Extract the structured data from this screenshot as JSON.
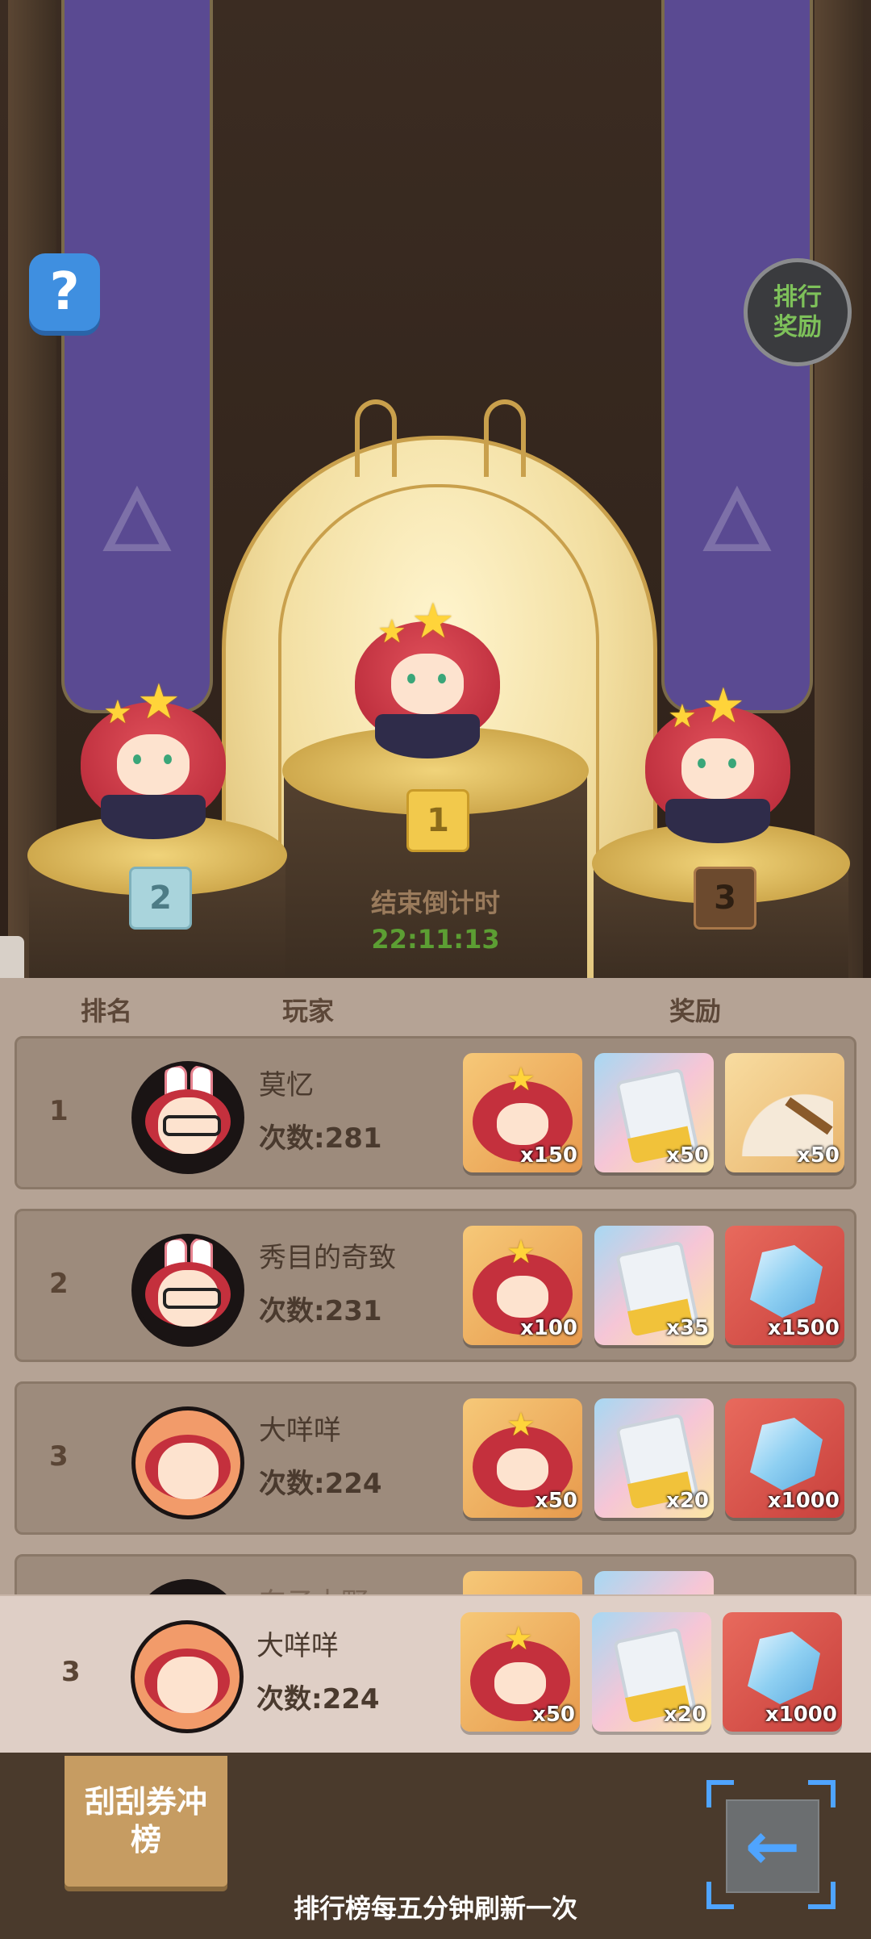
{
  "scene": {
    "help_label": "?",
    "reward_button_label": "排行\n奖励",
    "podium_badges": [
      "1",
      "2",
      "3"
    ],
    "countdown_label": "结束倒计时",
    "countdown_value": "22:11:13"
  },
  "table": {
    "headers": {
      "rank": "排名",
      "player": "玩家",
      "reward": "奖励"
    },
    "rows": [
      {
        "rank": "1",
        "name": "莫忆",
        "count": "次数:281",
        "rewards": [
          {
            "type": "hero",
            "qty": "x150"
          },
          {
            "type": "ticket",
            "qty": "x50"
          },
          {
            "type": "fan",
            "qty": "x50"
          }
        ]
      },
      {
        "rank": "2",
        "name": "秀目的奇致",
        "count": "次数:231",
        "rewards": [
          {
            "type": "hero",
            "qty": "x100"
          },
          {
            "type": "ticket",
            "qty": "x35"
          },
          {
            "type": "gem",
            "qty": "x1500"
          }
        ]
      },
      {
        "rank": "3",
        "name": "大咩咩",
        "count": "次数:224",
        "rewards": [
          {
            "type": "hero",
            "qty": "x50"
          },
          {
            "type": "ticket",
            "qty": "x20"
          },
          {
            "type": "gem",
            "qty": "x1000"
          }
        ]
      },
      {
        "rank": "",
        "name": "东子本野",
        "count": "",
        "rewards": []
      }
    ]
  },
  "my_rank": {
    "rank": "3",
    "name": "大咩咩",
    "count": "次数:224",
    "rewards": [
      {
        "type": "hero",
        "qty": "x50"
      },
      {
        "type": "ticket",
        "qty": "x20"
      },
      {
        "type": "gem",
        "qty": "x1000"
      }
    ]
  },
  "bottom": {
    "scratch_button": "刮刮券冲\n榜",
    "back_icon": "←",
    "refresh_note": "排行榜每五分钟刷新一次"
  },
  "colors": {
    "banner": "#5a4a92",
    "countdown": "#5c9e33",
    "accent_gold": "#c9a04c"
  }
}
